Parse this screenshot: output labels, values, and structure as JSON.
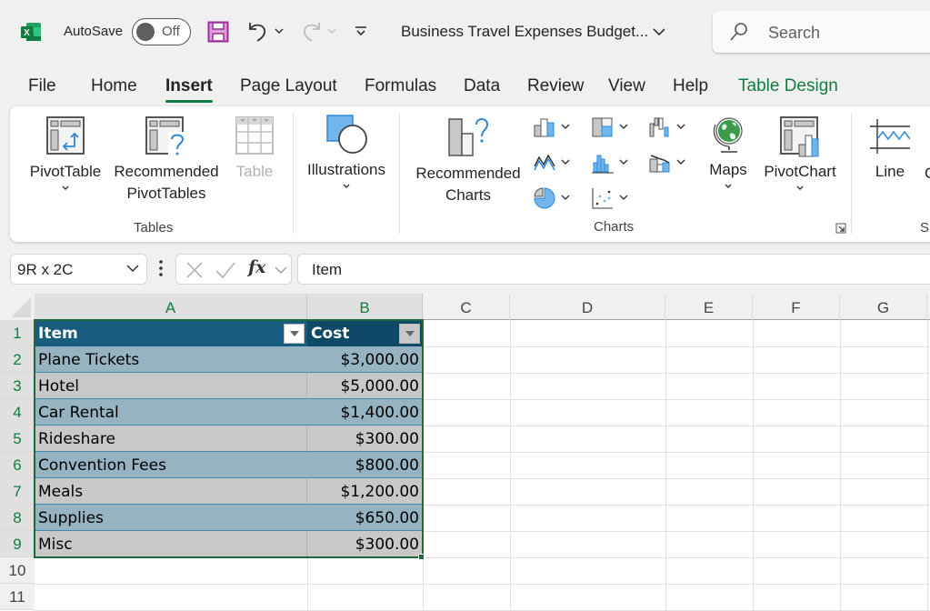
{
  "titlebar": {
    "app_icon": "excel-logo-icon",
    "autosave_label": "AutoSave",
    "autosave_state": "Off",
    "save_icon": "save-icon",
    "undo_icon": "undo-icon",
    "redo_icon": "redo-icon",
    "customize_icon": "customize-quick-access-icon",
    "document_title": "Business Travel Expenses Budget...",
    "search_placeholder": "Search"
  },
  "tabs": [
    {
      "label": "File"
    },
    {
      "label": "Home"
    },
    {
      "label": "Insert",
      "active": true
    },
    {
      "label": "Page Layout"
    },
    {
      "label": "Formulas"
    },
    {
      "label": "Data"
    },
    {
      "label": "Review"
    },
    {
      "label": "View"
    },
    {
      "label": "Help"
    },
    {
      "label": "Table Design",
      "contextual": true
    }
  ],
  "ribbon": {
    "groups": {
      "tables": {
        "label": "Tables",
        "pivot_table": "PivotTable",
        "recommended_pivot_line1": "Recommended",
        "recommended_pivot_line2": "PivotTables",
        "table": "Table"
      },
      "illustrations": {
        "label": "Illustrations"
      },
      "charts": {
        "label": "Charts",
        "recommended_line1": "Recommended",
        "recommended_line2": "Charts",
        "maps": "Maps",
        "pivot_chart": "PivotChart",
        "mini_icons": [
          "column-chart-icon",
          "hierarchy-chart-icon",
          "waterfall-chart-icon",
          "line-chart-icon",
          "statistic-chart-icon",
          "combo-chart-icon",
          "pie-chart-icon",
          "scatter-chart-icon"
        ]
      },
      "sparklines": {
        "label": "Sp",
        "line": "Line",
        "column_partial": "C"
      }
    }
  },
  "formula_bar": {
    "name_box": "9R x 2C",
    "formula": "Item"
  },
  "sheet": {
    "columns": [
      "A",
      "B",
      "C",
      "D",
      "E",
      "F",
      "G"
    ],
    "rows": [
      "1",
      "2",
      "3",
      "4",
      "5",
      "6",
      "7",
      "8",
      "9",
      "10",
      "11"
    ],
    "table": {
      "headers": [
        "Item",
        "Cost"
      ],
      "rows": [
        {
          "item": "Plane Tickets",
          "cost": "$3,000.00"
        },
        {
          "item": "Hotel",
          "cost": "$5,000.00"
        },
        {
          "item": "Car Rental",
          "cost": "$1,400.00"
        },
        {
          "item": "Rideshare",
          "cost": "$300.00"
        },
        {
          "item": "Convention Fees",
          "cost": "$800.00"
        },
        {
          "item": "Meals",
          "cost": "$1,200.00"
        },
        {
          "item": "Supplies",
          "cost": "$650.00"
        },
        {
          "item": "Misc",
          "cost": "$300.00"
        }
      ]
    }
  },
  "colors": {
    "accent": "#107c41",
    "table_header": "#175d80",
    "band_light": "#95b3c0",
    "band_gray": "#c8c8c8"
  }
}
